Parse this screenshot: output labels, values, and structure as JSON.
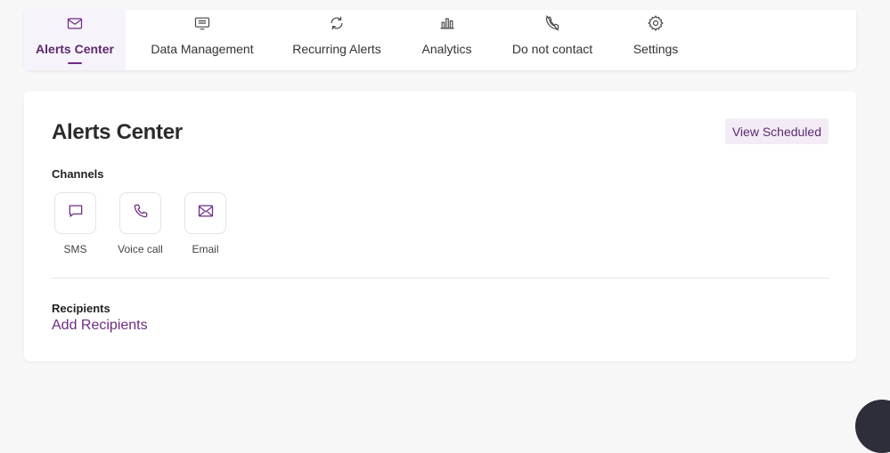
{
  "nav": {
    "items": [
      {
        "label": "Alerts Center",
        "icon": "envelope-icon",
        "active": true
      },
      {
        "label": "Data Management",
        "icon": "list-icon",
        "active": false
      },
      {
        "label": "Recurring Alerts",
        "icon": "refresh-icon",
        "active": false
      },
      {
        "label": "Analytics",
        "icon": "bar-chart-icon",
        "active": false
      },
      {
        "label": "Do not contact",
        "icon": "phone-off-icon",
        "active": false
      },
      {
        "label": "Settings",
        "icon": "gear-icon",
        "active": false
      }
    ]
  },
  "main": {
    "title": "Alerts Center",
    "view_scheduled_label": "View Scheduled",
    "channels_label": "Channels",
    "channels": [
      {
        "label": "SMS",
        "icon": "chat-bubble-icon"
      },
      {
        "label": "Voice call",
        "icon": "phone-icon"
      },
      {
        "label": "Email",
        "icon": "envelope-icon"
      }
    ],
    "recipients_label": "Recipients",
    "add_recipients_label": "Add Recipients"
  },
  "colors": {
    "accent": "#6e2c83",
    "active_bg": "#f7f3fb",
    "button_bg": "#f3ecf6"
  }
}
